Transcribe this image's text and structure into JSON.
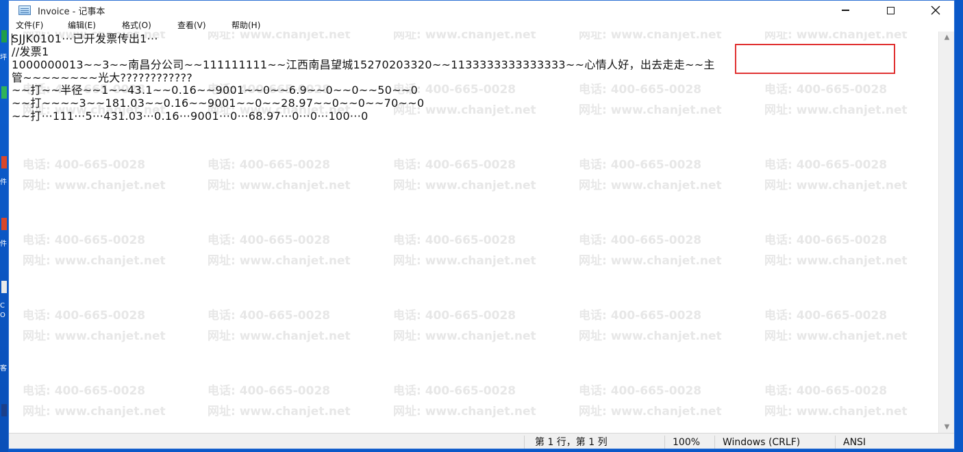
{
  "window": {
    "title": "Invoice - 记事本",
    "controls": {
      "minimize": "minimize",
      "maximize": "maximize",
      "close": "close"
    }
  },
  "menu": [
    {
      "label": "文件(F)"
    },
    {
      "label": "编辑(E)"
    },
    {
      "label": "格式(O)"
    },
    {
      "label": "查看(V)"
    },
    {
      "label": "帮助(H)"
    }
  ],
  "editor": {
    "lines": [
      "SJJK0101···已开发票传出1···",
      "//发票1",
      "1000000013~~3~~南昌分公司~~111111111~~江西南昌望城15270203320~~1133333333333333~~心情人好，出去走走~~主",
      "管~~~~~~~~光大????????????",
      "~~打~~半径~~1~~43.1~~0.16~~9001~~0~~6.9~~0~~0~~50~~0",
      "~~打~~~~3~~181.03~~0.16~~9001~~0~~28.97~~0~~0~~70~~0",
      "~~打···111···5···431.03···0.16···9001···0···68.97···0···0···100···0"
    ],
    "highlight_color": "#e03030"
  },
  "watermark": {
    "phone": "电话: 400-665-0028",
    "site": "网址: www.chanjet.net",
    "color": "#e7e7e7"
  },
  "statusbar": {
    "position": "第 1 行，第 1 列",
    "zoom": "100%",
    "line_ending": "Windows (CRLF)",
    "encoding": "ANSI"
  },
  "desktop": {
    "labels": [
      "坪",
      "件",
      "件",
      "C",
      "O",
      "客"
    ]
  },
  "colors": {
    "desktop_bg": "#0a58c8",
    "window_border": "#2b6fd3",
    "status_bg": "#f0f0f0"
  }
}
